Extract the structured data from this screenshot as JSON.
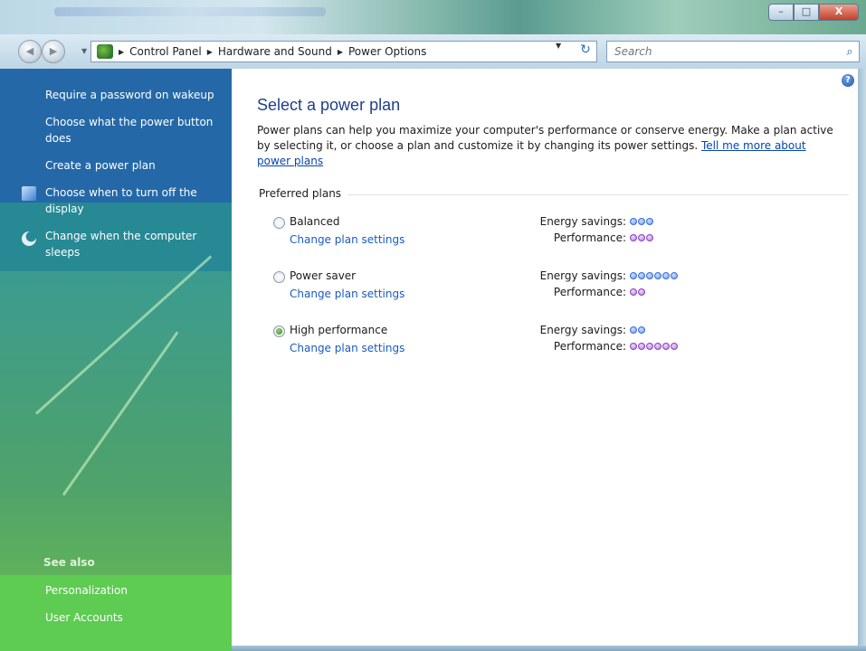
{
  "window": {
    "minimize_glyph": "–",
    "maximize_glyph": "□",
    "close_glyph": "X"
  },
  "address_bar": {
    "breadcrumbs": [
      "Control Panel",
      "Hardware and Sound",
      "Power Options"
    ],
    "search_placeholder": "Search",
    "icons": {
      "back": "back-arrow-icon",
      "forward": "forward-arrow-icon",
      "control_panel": "control-panel-icon",
      "refresh": "refresh-icon",
      "search": "search-icon"
    }
  },
  "sidebar": {
    "links": [
      {
        "label": "Require a password on wakeup"
      },
      {
        "label": "Choose what the power button does"
      },
      {
        "label": "Create a power plan"
      },
      {
        "label": "Choose when to turn off the display",
        "icon": "display-icon"
      },
      {
        "label": "Change when the computer sleeps",
        "icon": "sleep-moon-icon"
      }
    ],
    "see_also_heading": "See also",
    "see_also": [
      {
        "label": "Personalization"
      },
      {
        "label": "User Accounts"
      }
    ]
  },
  "main": {
    "help_glyph": "?",
    "title": "Select a power plan",
    "intro_text": "Power plans can help you maximize your computer's performance or conserve energy. Make a plan active by selecting it, or choose a plan and customize it by changing its power settings. ",
    "intro_link": "Tell me more about power plans",
    "group_label": "Preferred plans",
    "energy_label": "Energy savings:",
    "performance_label": "Performance:",
    "plans": [
      {
        "name": "Balanced",
        "link": "Change plan settings",
        "selected": false,
        "energy_savings": 3,
        "performance": 3
      },
      {
        "name": "Power saver",
        "link": "Change plan settings",
        "selected": false,
        "energy_savings": 6,
        "performance": 2
      },
      {
        "name": "High performance",
        "link": "Change plan settings",
        "selected": true,
        "energy_savings": 2,
        "performance": 6
      }
    ],
    "colors": {
      "energy_dot": "#6f98ea",
      "performance_dot": "#b27ad6",
      "title": "#1e3f8a",
      "link": "#1a5bbf"
    }
  }
}
